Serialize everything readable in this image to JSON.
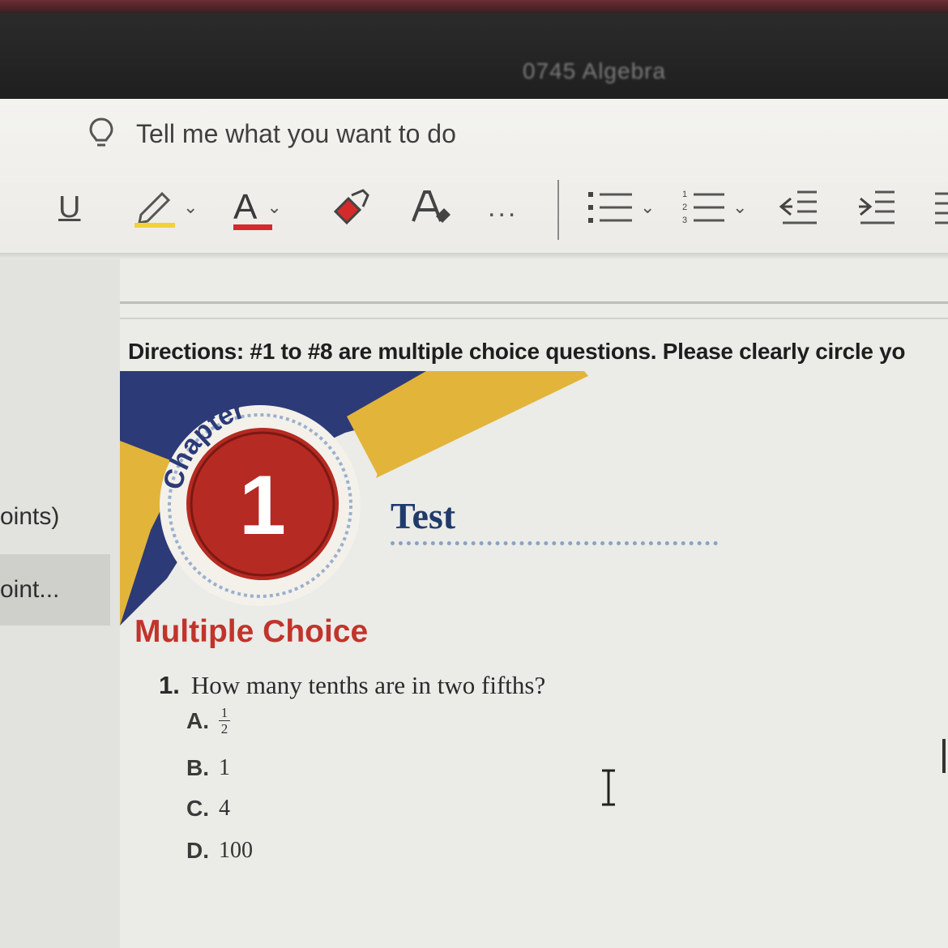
{
  "window": {
    "title": "0745 Algebra"
  },
  "ribbon": {
    "tell_me": "Tell me what you want to do",
    "underline_label": "U",
    "font_color_label": "A",
    "more_label": "...",
    "colors": {
      "highlight": "#f2d23a",
      "font_color": "#d42a2a"
    }
  },
  "sidebar": {
    "items": [
      {
        "label": "oints)"
      },
      {
        "label": "oint..."
      }
    ]
  },
  "document": {
    "directions": "Directions: #1 to #8 are multiple choice questions. Please clearly circle yo",
    "chapter_word": "Chapter",
    "chapter_number": "1",
    "test_label": "Test",
    "section_heading": "Multiple Choice",
    "question": {
      "number": "1.",
      "text": "How many tenths are in two fifths?",
      "options": [
        {
          "letter": "A.",
          "numerator": "1",
          "denominator": "2"
        },
        {
          "letter": "B.",
          "value": "1"
        },
        {
          "letter": "C.",
          "value": "4"
        },
        {
          "letter": "D.",
          "value": "100"
        }
      ]
    },
    "colors": {
      "heading": "#c1342b",
      "test": "#1f3a6b",
      "badge": "#b52a22",
      "gold": "#e2b43a",
      "navy": "#2c3a78"
    }
  }
}
